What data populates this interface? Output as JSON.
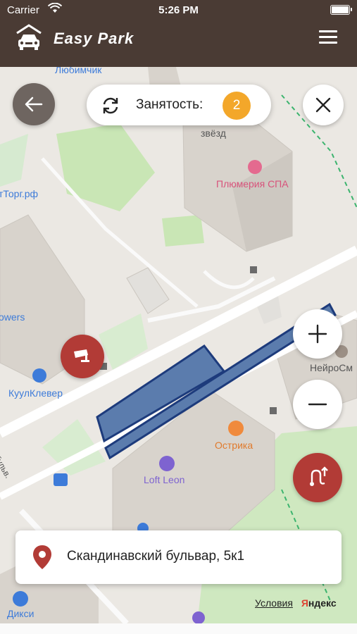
{
  "status_bar": {
    "carrier": "Carrier",
    "time": "5:26 PM"
  },
  "header": {
    "title": "Easy Park"
  },
  "occupancy": {
    "label": "Занятость:",
    "count": "2"
  },
  "map_labels": {
    "lyubimchik": "Любимчик",
    "zvezd": "звёзд",
    "plumeria": "Плюмерия СПА",
    "torg": "тТорг.рф",
    "owers": "owers",
    "kuulklever": "КуулКлевер",
    "neyro": "НейроСм",
    "ostrika": "Острика",
    "loft": "Loft Leon",
    "bulvar": "й бульв.",
    "diksi": "Дикси"
  },
  "address": {
    "text": "Скандинавский бульвар, 5к1"
  },
  "footer": {
    "conditions": "Условия",
    "yandex_first": "Я",
    "yandex_rest": "ндекс"
  },
  "colors": {
    "brand": "#4a3b34",
    "badge": "#f3a72a",
    "danger": "#b23b36",
    "zone_fill": "#5b7cad",
    "zone_stroke": "#1d3b7c"
  }
}
